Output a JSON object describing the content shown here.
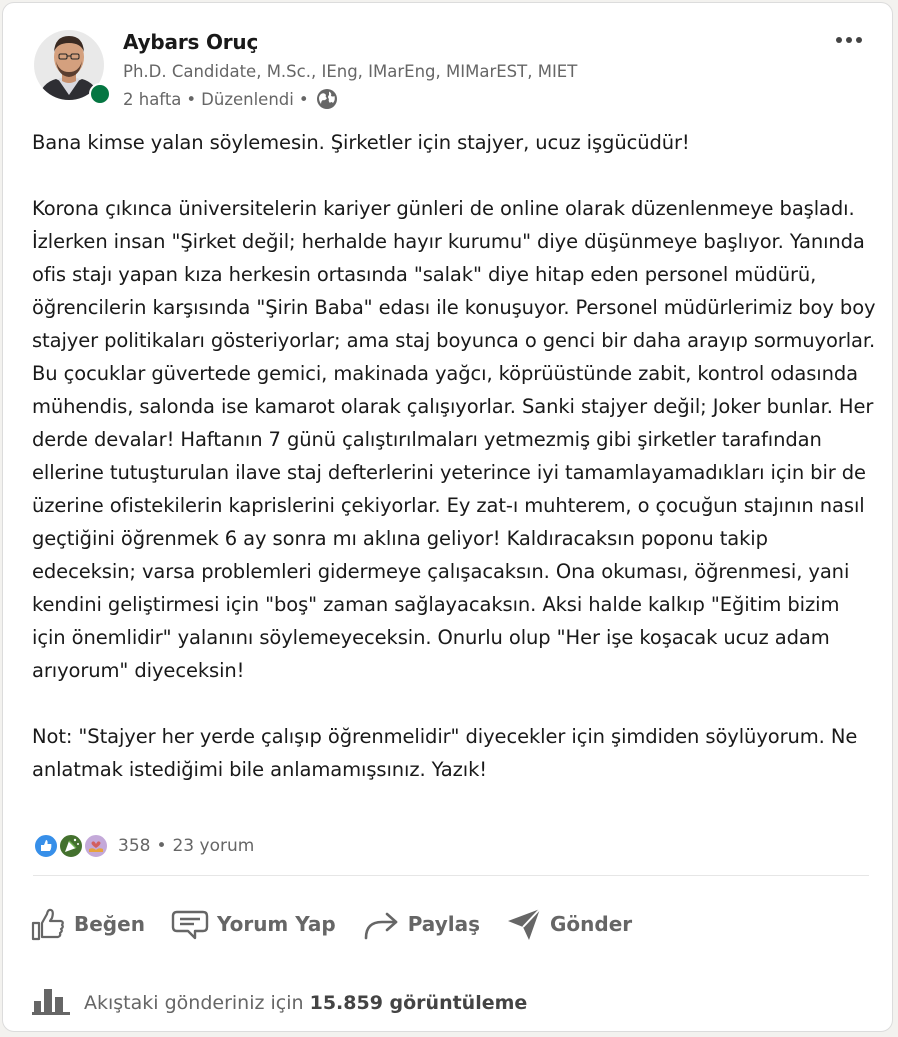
{
  "post": {
    "author": {
      "name": "Aybars Oruç",
      "headline": "Ph.D. Candidate, M.Sc., IEng, IMarEng, MIMarEST, MIET",
      "time": "2 hafta",
      "edited": "Düzenlendi",
      "separator": "•",
      "visibility_icon": "globe-icon",
      "presence_color": "#057642"
    },
    "more_icon": "ellipsis-icon",
    "body": {
      "p1": "Bana kimse yalan söylemesin. Şirketler için stajyer, ucuz işgücüdür!",
      "p2": "Korona çıkınca üniversitelerin kariyer günleri de online olarak düzenlenmeye başladı. İzlerken insan \"Şirket değil; herhalde hayır kurumu\" diye düşünmeye başlıyor. Yanında ofis stajı yapan kıza herkesin ortasında \"salak\" diye hitap eden personel müdürü, öğrencilerin karşısında \"Şirin Baba\" edası ile konuşuyor. Personel müdürlerimiz boy boy stajyer politikaları gösteriyorlar; ama staj boyunca o genci bir daha arayıp sormuyorlar. Bu çocuklar güvertede gemici, makinada yağcı, köprüüstünde zabit, kontrol odasında mühendis, salonda ise kamarot olarak çalışıyorlar. Sanki stajyer değil; Joker bunlar. Her derde devalar! Haftanın 7 günü çalıştırılmaları yetmezmiş gibi şirketler tarafından ellerine tutuşturulan ilave staj defterlerini yeterince iyi tamamlayamadıkları için bir de üzerine ofistekilerin kaprislerini çekiyorlar. Ey zat-ı muhterem, o çocuğun stajının nasıl geçtiğini öğrenmek 6 ay sonra mı aklına geliyor! Kaldıracaksın poponu takip edeceksin; varsa problemleri gidermeye çalışacaksın. Ona okuması, öğrenmesi, yani kendini geliştirmesi için \"boş\" zaman sağlayacaksın. Aksi halde kalkıp \"Eğitim bizim için önemlidir\" yalanını söylemeyeceksin. Onurlu olup \"Her işe koşacak ucuz adam arıyorum\" diyeceksin!",
      "p3": "Not: \"Stajyer her yerde çalışıp öğrenmelidir\" diyecekler için şimdiden söylüyorum. Ne anlatmak istediğimi bile anlamamışsınız. Yazık!"
    },
    "social": {
      "reactions": [
        "like-reaction-icon",
        "celebrate-reaction-icon",
        "support-reaction-icon"
      ],
      "reaction_count": "358",
      "separator": "•",
      "comments": "23 yorum"
    },
    "actions": {
      "like": "Beğen",
      "comment": "Yorum Yap",
      "share": "Paylaş",
      "send": "Gönder"
    },
    "views": {
      "prefix": "Akıştaki gönderiniz için",
      "count": "15.859 görüntüleme"
    }
  }
}
